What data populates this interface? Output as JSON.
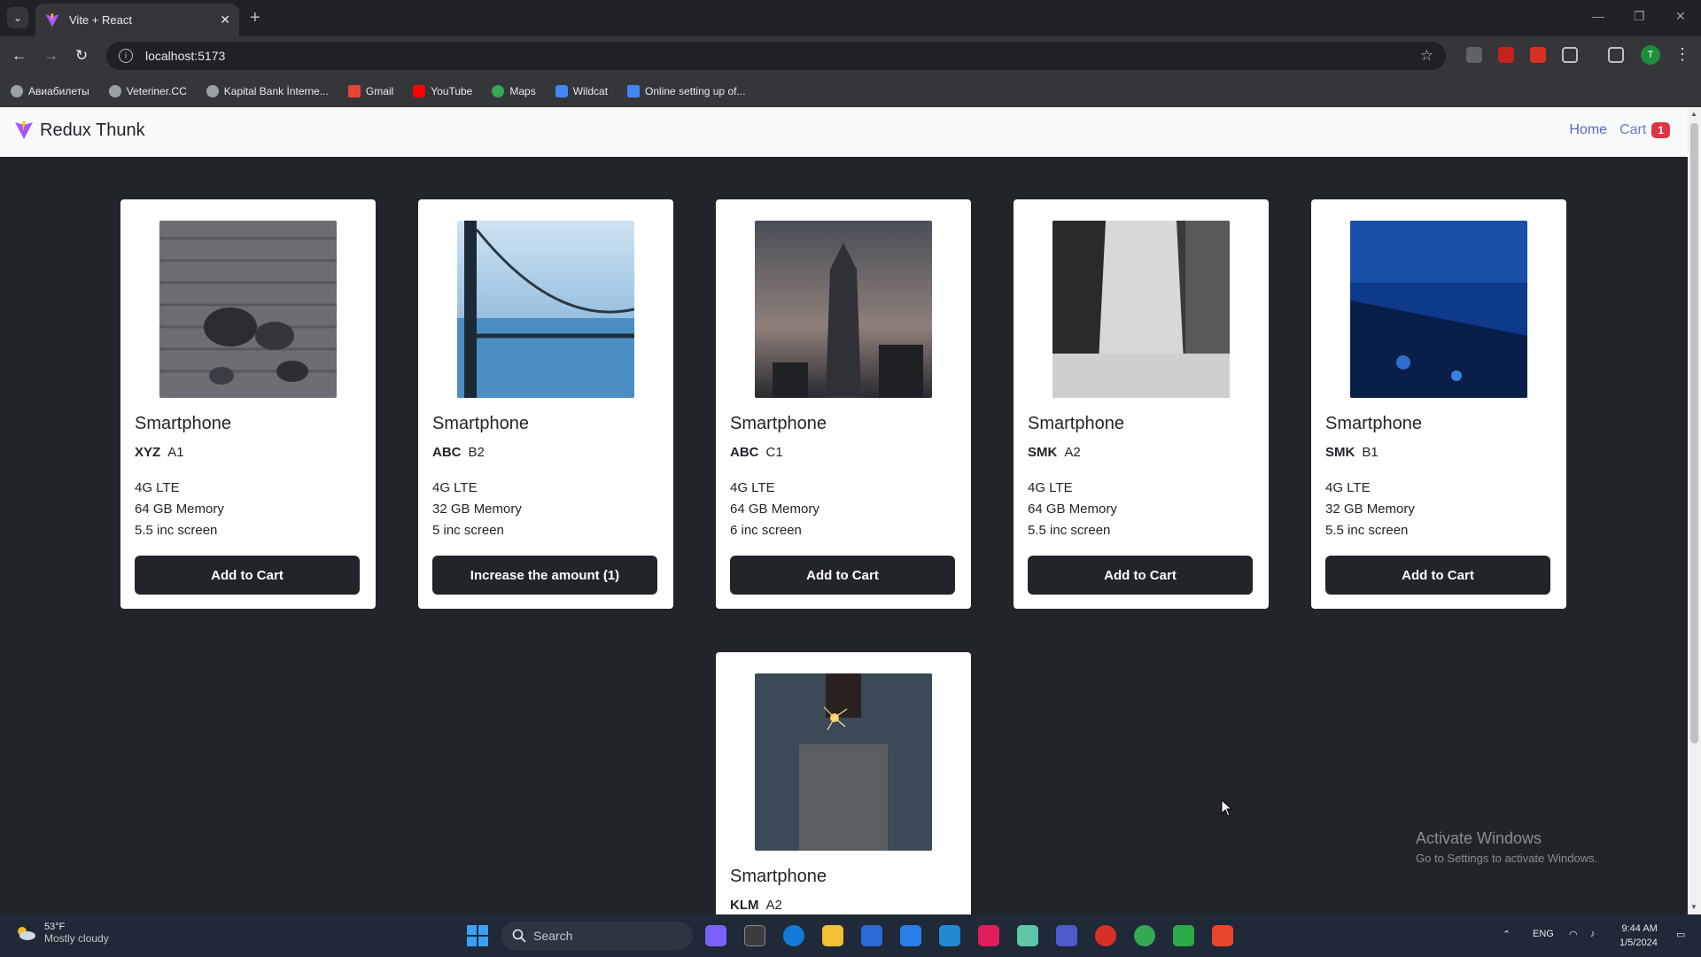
{
  "browser": {
    "tab_title": "Vite + React",
    "tab_close": "✕",
    "new_tab": "+",
    "url": "localhost:5173",
    "bookmarks": [
      {
        "label": "Авиабилеты",
        "color": "#9aa0a6"
      },
      {
        "label": "Veteriner.CC",
        "color": "#9aa0a6"
      },
      {
        "label": "Kapital Bank İnterne...",
        "color": "#9aa0a6"
      },
      {
        "label": "Gmail",
        "color": "#ea4335"
      },
      {
        "label": "YouTube",
        "color": "#ff0000"
      },
      {
        "label": "Maps",
        "color": "#34a853"
      },
      {
        "label": "Wildcat",
        "color": "#4285f4"
      },
      {
        "label": "Online setting up of...",
        "color": "#4285f4"
      }
    ],
    "profile_initial": "T"
  },
  "app": {
    "brand": "Redux Thunk",
    "nav": {
      "home": "Home",
      "cart": "Cart",
      "cart_count": "1"
    },
    "products": [
      {
        "title": "Smartphone",
        "brand": "XYZ",
        "model": "A1",
        "network": "4G LTE",
        "memory": "64 GB Memory",
        "screen": "5.5 inc screen",
        "button": "Add to Cart"
      },
      {
        "title": "Smartphone",
        "brand": "ABC",
        "model": "B2",
        "network": "4G LTE",
        "memory": "32 GB Memory",
        "screen": "5 inc screen",
        "button": "Increase the amount (1)"
      },
      {
        "title": "Smartphone",
        "brand": "ABC",
        "model": "C1",
        "network": "4G LTE",
        "memory": "64 GB Memory",
        "screen": "6 inc screen",
        "button": "Add to Cart"
      },
      {
        "title": "Smartphone",
        "brand": "SMK",
        "model": "A2",
        "network": "4G LTE",
        "memory": "64 GB Memory",
        "screen": "5.5 inc screen",
        "button": "Add to Cart"
      },
      {
        "title": "Smartphone",
        "brand": "SMK",
        "model": "B1",
        "network": "4G LTE",
        "memory": "32 GB Memory",
        "screen": "5.5 inc screen",
        "button": "Add to Cart"
      },
      {
        "title": "Smartphone",
        "brand": "KLM",
        "model": "A2"
      }
    ]
  },
  "watermark": {
    "title": "Activate Windows",
    "subtitle": "Go to Settings to activate Windows."
  },
  "taskbar": {
    "weather_temp": "53°F",
    "weather_desc": "Mostly cloudy",
    "search_placeholder": "Search",
    "language": "ENG",
    "time": "9:44 AM",
    "date": "1/5/2024"
  }
}
